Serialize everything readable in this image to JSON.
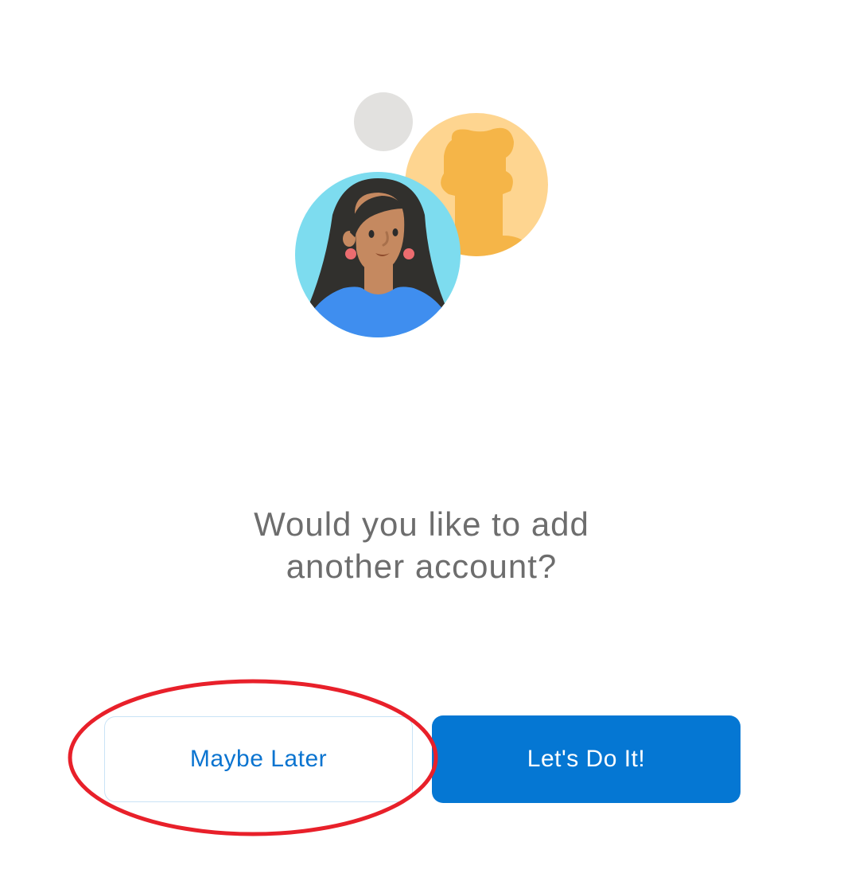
{
  "prompt": {
    "line1": "Would you like to add",
    "line2": "another account?"
  },
  "buttons": {
    "secondary_label": "Maybe Later",
    "primary_label": "Let's Do It!"
  },
  "colors": {
    "primary": "#0577d3",
    "secondary_text": "#0b74d0",
    "secondary_border": "#c9e3f6",
    "prompt_text": "#6d6d6d",
    "annotation": "#e8202a"
  },
  "illustration": {
    "icons": [
      "small-gray-dot-icon",
      "person-silhouette-avatar-icon",
      "woman-avatar-icon"
    ]
  }
}
